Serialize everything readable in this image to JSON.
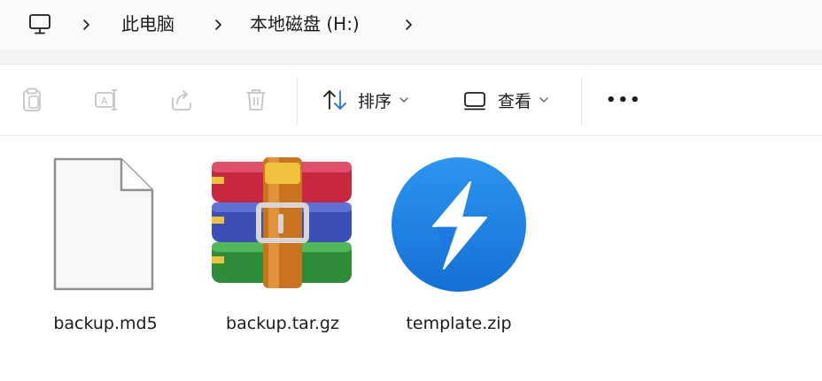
{
  "breadcrumb": {
    "items": [
      {
        "label": "此电脑"
      },
      {
        "label": "本地磁盘 (H:)"
      }
    ]
  },
  "toolbar": {
    "sort_label": "排序",
    "view_label": "查看",
    "more_label": "•••"
  },
  "files": [
    {
      "name": "backup.md5",
      "icon": "generic-file-icon"
    },
    {
      "name": "backup.tar.gz",
      "icon": "winrar-archive-icon"
    },
    {
      "name": "template.zip",
      "icon": "bandizip-archive-icon"
    }
  ],
  "colors": {
    "accent_blue": "#1a73e8",
    "winrar_red": "#c7283f",
    "winrar_blue": "#3b4fb7",
    "winrar_green": "#2e8d3a",
    "winrar_strap": "#c9741d",
    "bandizip_blue": "#1f86e6"
  }
}
